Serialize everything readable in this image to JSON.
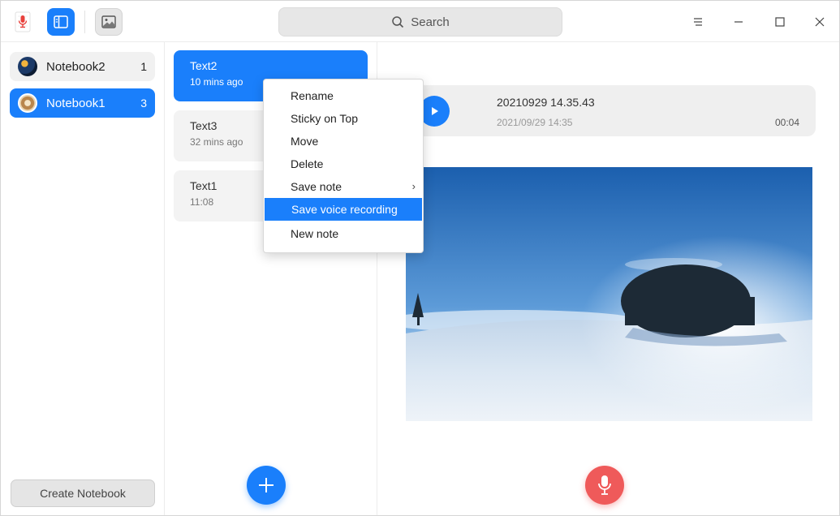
{
  "toolbar": {
    "search_placeholder": "Search"
  },
  "sidebar": {
    "notebooks": [
      {
        "name": "Notebook2",
        "count": "1"
      },
      {
        "name": "Notebook1",
        "count": "3"
      }
    ],
    "create_label": "Create Notebook"
  },
  "notes": [
    {
      "title": "Text2",
      "time": "10 mins ago"
    },
    {
      "title": "Text3",
      "time": "32 mins ago"
    },
    {
      "title": "Text1",
      "time": "11:08"
    }
  ],
  "context_menu": {
    "items": [
      "Rename",
      "Sticky on Top",
      "Move",
      "Delete",
      "Save note",
      "Save voice recording",
      "New note"
    ],
    "selected": "Save voice recording"
  },
  "voice": {
    "title": "20210929 14.35.43",
    "date": "2021/09/29 14:35",
    "duration": "00:04"
  },
  "colors": {
    "accent": "#1a7ffb",
    "record": "#ef5a5a"
  }
}
